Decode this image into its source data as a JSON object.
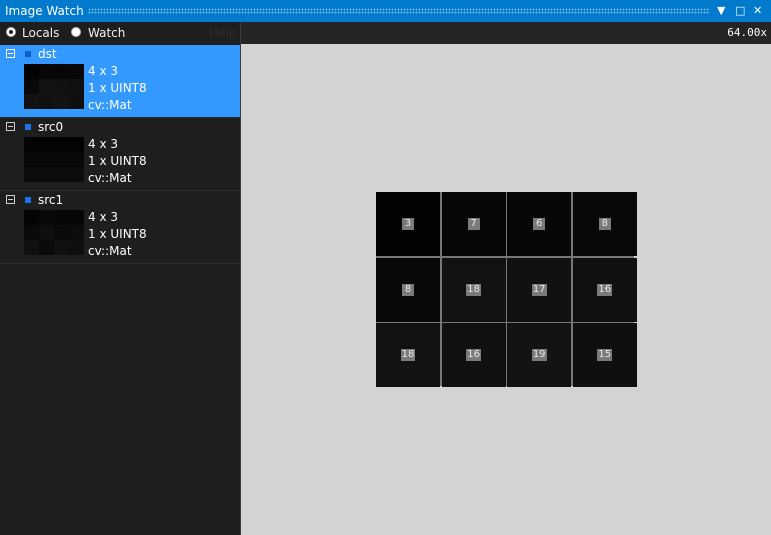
{
  "window": {
    "title": "Image Watch",
    "controls": {
      "dropdown": "▼",
      "maximize": "□",
      "close": "✕"
    }
  },
  "options": {
    "locals_label": "Locals",
    "watch_label": "Watch",
    "help_label": "Help",
    "selected": "Locals"
  },
  "variables": [
    {
      "name": "dst",
      "size": "4 x 3",
      "channels": "1 x UINT8",
      "type": "cv::Mat",
      "selected": true,
      "pixels": [
        [
          3,
          7,
          6,
          8
        ],
        [
          8,
          18,
          17,
          16
        ],
        [
          18,
          16,
          19,
          15
        ]
      ]
    },
    {
      "name": "src0",
      "size": "4 x 3",
      "channels": "1 x UINT8",
      "type": "cv::Mat",
      "selected": false,
      "pixels": [
        [
          4,
          4,
          4,
          4
        ],
        [
          8,
          8,
          8,
          8
        ],
        [
          12,
          12,
          12,
          12
        ]
      ]
    },
    {
      "name": "src1",
      "size": "4 x 3",
      "channels": "1 x UINT8",
      "type": "cv::Mat",
      "selected": false,
      "pixels": [
        [
          4,
          8,
          6,
          6
        ],
        [
          10,
          14,
          10,
          12
        ],
        [
          16,
          10,
          16,
          14
        ]
      ]
    }
  ],
  "viewer": {
    "zoom": "64.00x",
    "pixels": [
      [
        3,
        7,
        6,
        8
      ],
      [
        8,
        18,
        17,
        16
      ],
      [
        18,
        16,
        19,
        15
      ]
    ]
  },
  "colors": {
    "accent": "#007acc",
    "selection": "#3399ff",
    "canvas": "#d3d3d3"
  }
}
